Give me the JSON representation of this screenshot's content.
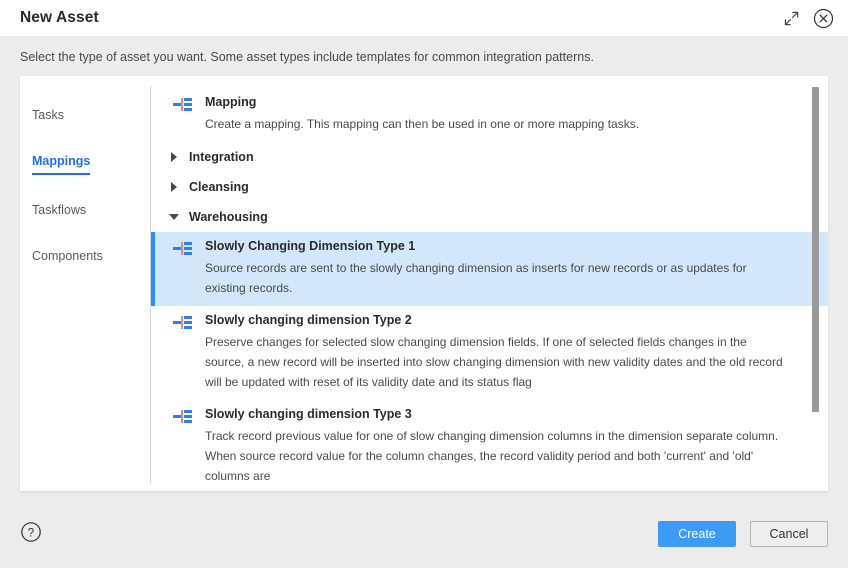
{
  "header": {
    "title": "New Asset",
    "expand_icon": "expand-arrows-icon",
    "close_icon": "close-circle-icon"
  },
  "subtitle": "Select the type of asset you want. Some asset types include templates for common integration patterns.",
  "sidebar": {
    "items": [
      {
        "label": "Tasks",
        "active": false
      },
      {
        "label": "Mappings",
        "active": true
      },
      {
        "label": "Taskflows",
        "active": false
      },
      {
        "label": "Components",
        "active": false
      }
    ]
  },
  "list": {
    "top_asset": {
      "icon": "mapping-icon",
      "title": "Mapping",
      "description": "Create a mapping. This mapping can then be used in one or more mapping tasks."
    },
    "groups": [
      {
        "label": "Integration",
        "expanded": false
      },
      {
        "label": "Cleansing",
        "expanded": false
      },
      {
        "label": "Warehousing",
        "expanded": true
      }
    ],
    "warehousing_items": [
      {
        "icon": "mapping-icon",
        "title": "Slowly Changing Dimension Type 1",
        "description": "Source records are sent to the slowly changing dimension as inserts for new records or as updates for existing records.",
        "selected": true
      },
      {
        "icon": "mapping-icon",
        "title": "Slowly changing dimension Type 2",
        "description": "Preserve changes for selected slow changing dimension fields. If one of selected fields changes in the source, a new record will be inserted into slow changing dimension with new validity dates and the old record will be updated with reset of its validity date and its status flag",
        "selected": false
      },
      {
        "icon": "mapping-icon",
        "title": "Slowly changing dimension Type 3",
        "description": "Track record previous value for one of slow changing dimension columns in the dimension separate column. When source record value for the column changes, the record validity period and both 'current' and 'old' columns are",
        "selected": false
      }
    ]
  },
  "footer": {
    "help_icon": "help-circle-icon",
    "create_label": "Create",
    "cancel_label": "Cancel"
  },
  "colors": {
    "accent_blue": "#1f6fe5",
    "primary_button": "#3c9bf5",
    "selected_row_bg": "#d3e7fa",
    "selected_row_border": "#2d8ef5",
    "icon_blue": "#2d7ff0",
    "icon_orange": "#f08a4b",
    "body_bg": "#ececec"
  }
}
